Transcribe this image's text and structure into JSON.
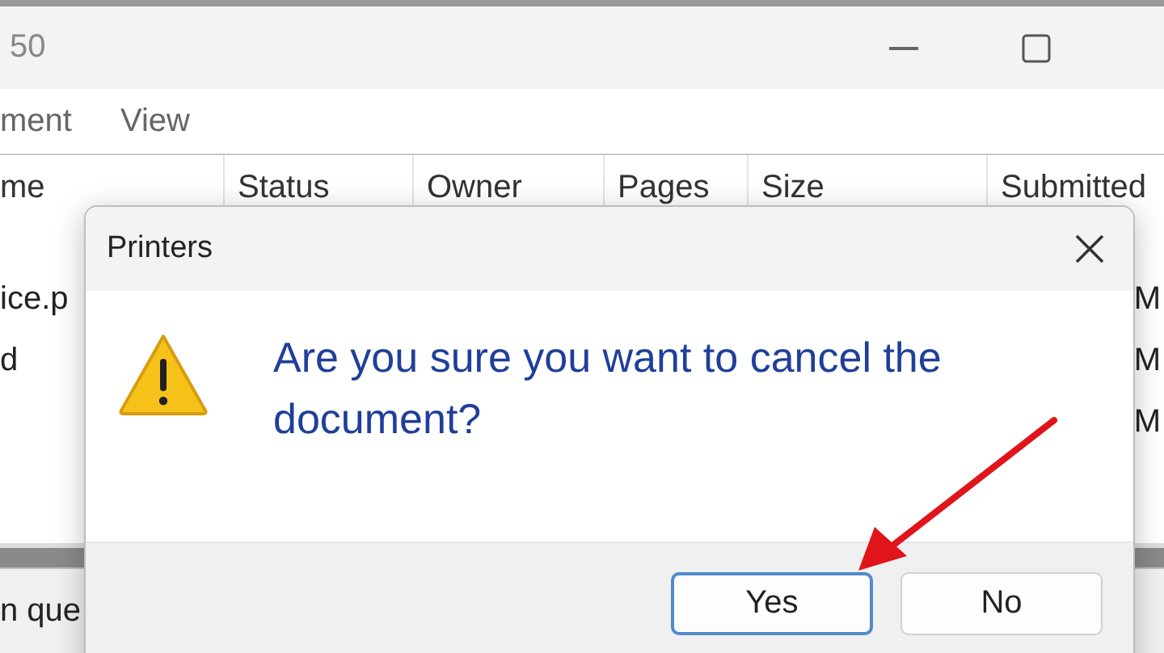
{
  "window": {
    "title": "50"
  },
  "menu": [
    "ment",
    "View"
  ],
  "table": {
    "columns": [
      "me",
      "Status",
      "Owner",
      "Pages",
      "Size",
      "Submitted"
    ],
    "rows": [
      {
        "column_1": "ice.p",
        "column_6": "M"
      },
      {
        "column_1": "d",
        "column_6": "M"
      },
      {
        "column_1": "",
        "column_6": "M"
      }
    ]
  },
  "status_bar": "n que",
  "dialog": {
    "title": "Printers",
    "message": "Are you sure you want to cancel the document?",
    "buttons": [
      {
        "label": "Yes",
        "selected": true
      },
      {
        "label": "No",
        "selected": false
      }
    ]
  }
}
